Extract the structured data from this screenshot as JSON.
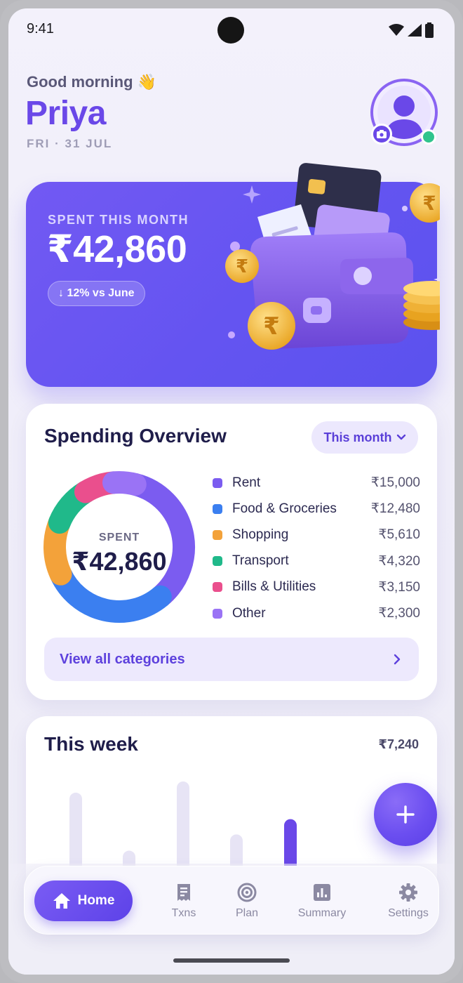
{
  "status_bar": {
    "time": "9:41"
  },
  "header": {
    "greeting": "Good morning 👋",
    "name": "Priya",
    "date": "FRI · 31 JUL"
  },
  "hero": {
    "label": "SPENT THIS MONTH",
    "amount": "₹42,860",
    "trend": "↓ 12% vs June"
  },
  "overview": {
    "title": "Spending Overview",
    "period": "This month",
    "donut_label": "SPENT",
    "donut_amount": "₹42,860",
    "categories": [
      {
        "name": "Rent",
        "amount": "₹15,000",
        "value": 15000,
        "color": "#7b5cf0"
      },
      {
        "name": "Food & Groceries",
        "amount": "₹12,480",
        "value": 12480,
        "color": "#3b7ff0"
      },
      {
        "name": "Shopping",
        "amount": "₹5,610",
        "value": 5610,
        "color": "#f3a23a"
      },
      {
        "name": "Transport",
        "amount": "₹4,320",
        "value": 4320,
        "color": "#20b98a"
      },
      {
        "name": "Bills & Utilities",
        "amount": "₹3,150",
        "value": 3150,
        "color": "#ea4f8d"
      },
      {
        "name": "Other",
        "amount": "₹2,300",
        "value": 2300,
        "color": "#9a73f5"
      }
    ],
    "view_all": "View all categories"
  },
  "week": {
    "title": "This week",
    "total": "₹7,240",
    "bar_levels": [
      0.78,
      0.21,
      0.89,
      0.37,
      0.52
    ],
    "highlight_index": 4
  },
  "nav": {
    "items": [
      {
        "label": "Home",
        "icon": "home-icon",
        "active": true
      },
      {
        "label": "Txns",
        "icon": "receipt-icon"
      },
      {
        "label": "Plan",
        "icon": "target-icon"
      },
      {
        "label": "Summary",
        "icon": "bar-chart-icon"
      },
      {
        "label": "Settings",
        "icon": "gear-icon"
      }
    ]
  },
  "colors": {
    "accent": "#6a48e8",
    "hero": "#6454f1",
    "online": "#30c48d"
  }
}
